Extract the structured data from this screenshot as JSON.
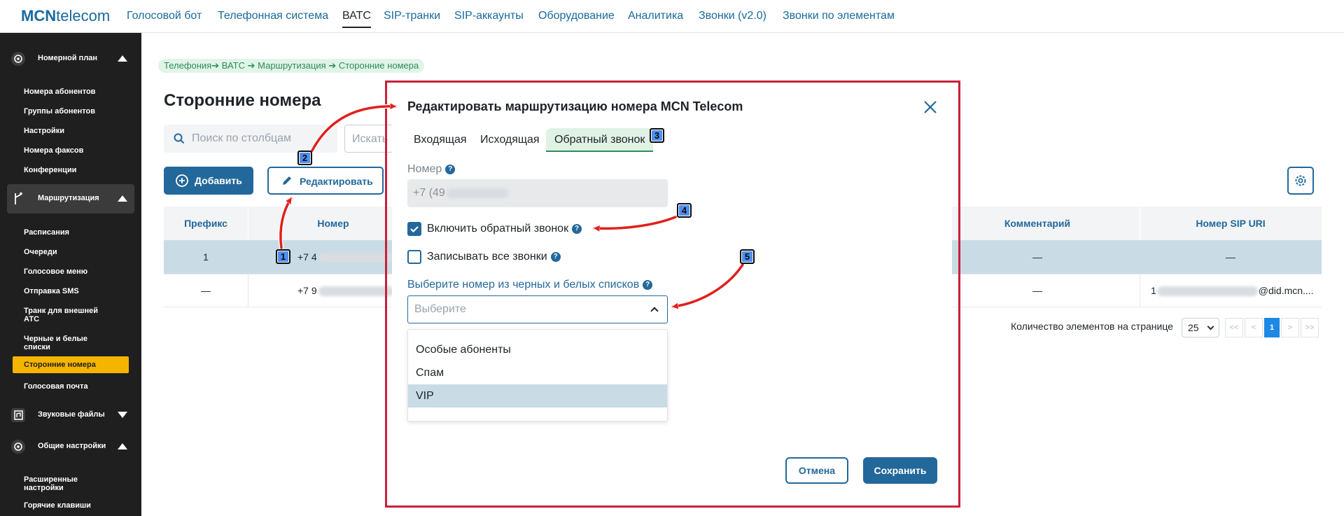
{
  "brand": {
    "prefix": "MCN",
    "suffix": "telecom"
  },
  "topnav": [
    "Голосовой бот",
    "Телефонная система",
    "ВАТС",
    "SIP-транки",
    "SIP-аккаунты",
    "Оборудование",
    "Аналитика",
    "Звонки (v2.0)",
    "Звонки по элементам"
  ],
  "sidebar": {
    "numbering": "Номерной план",
    "numbering_items": [
      "Номера абонентов",
      "Группы абонентов",
      "Настройки",
      "Номера факсов",
      "Конференции"
    ],
    "routing": "Маршрутизация",
    "routing_items": [
      "Расписания",
      "Очереди",
      "Голосовое меню",
      "Отправка SMS",
      "Транк для внешней",
      "АТС",
      "Черные и белые",
      "списки",
      "Сторонние номера",
      "Голосовая почта"
    ],
    "sounds": "Звуковые файлы",
    "general": "Общие настройки",
    "general_items": [
      "Расширенные",
      "настройки",
      "Горячие клавиши"
    ]
  },
  "breadcrumb": [
    "Телефония",
    "ВАТС",
    "Маршрутизация",
    "Сторонние номера"
  ],
  "page_title": "Сторонние номера",
  "search": {
    "placeholder1": "Поиск по столбцам",
    "placeholder2": "Искать"
  },
  "buttons": {
    "add": "Добавить",
    "edit": "Редактировать"
  },
  "table": {
    "headers": [
      "Префикс",
      "Номер",
      "Комментарий",
      "Номер SIP URI"
    ],
    "rows": [
      {
        "prefix": "1",
        "number": "+7 4",
        "comment": "—",
        "sip": "—"
      },
      {
        "prefix": "—",
        "number": "+7 9",
        "comment": "—",
        "sip_prefix": "1",
        "sip_suffix": "@did.mcn...."
      }
    ]
  },
  "pager": {
    "label": "Количество элементов на странице",
    "page_size": "25",
    "first": "<<",
    "prev": "<",
    "current": "1",
    "next": ">",
    "last": ">>"
  },
  "modal": {
    "title": "Редактировать маршрутизацию номера MCN Telecom",
    "tabs": [
      "Входящая",
      "Исходящая",
      "Обратный звонок"
    ],
    "number_label": "Номер",
    "number_value": "+7 (49",
    "callback_label": "Включить обратный звонок",
    "callback_checked": true,
    "record_label": "Записывать все звонки",
    "record_checked": false,
    "list_label": "Выберите номер из черных и белых списков",
    "select_placeholder": "Выберите",
    "options": [
      "Особые абоненты",
      "Спам",
      "VIP"
    ],
    "cancel": "Отмена",
    "save": "Сохранить"
  },
  "help_glyph": "?",
  "callouts": [
    "1",
    "2",
    "3",
    "4",
    "5"
  ],
  "colors": {
    "brand": "#23689b",
    "sidebar_bg": "#1f1f1f",
    "sidebar_active": "#f5b400",
    "frame": "#c8213a",
    "arrow": "#e0201c",
    "callout": "#4f8ff0"
  }
}
